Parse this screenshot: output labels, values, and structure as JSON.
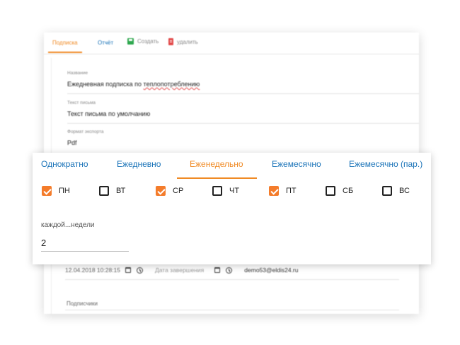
{
  "toolbar": {
    "tab_subscription": "Подписка",
    "tab_report": "Отчёт",
    "create_label": "Создать",
    "delete_label": "удалить"
  },
  "form": {
    "name_label": "Название",
    "name_value_prefix": "Ежедневная подписка по ",
    "name_value_underlined": "теплопотреблению",
    "letter_label": "Текст письма",
    "letter_value": "Текст письма по умолчанию",
    "export_label": "Формат экспорта",
    "export_value": "Pdf",
    "start_datetime": "12.04.2018 10:28:15",
    "end_date_placeholder": "Дата завершения",
    "email": "demo53@eldis24.ru",
    "subscribers_label": "Подписчики"
  },
  "schedule": {
    "tabs": [
      {
        "label": "Однократно",
        "active": false
      },
      {
        "label": "Ежедневно",
        "active": false
      },
      {
        "label": "Еженедельно",
        "active": true
      },
      {
        "label": "Ежемесячно",
        "active": false
      },
      {
        "label": "Ежемесячно (пар.)",
        "active": false
      }
    ],
    "days": [
      {
        "label": "ПН",
        "checked": true
      },
      {
        "label": "ВТ",
        "checked": false
      },
      {
        "label": "СР",
        "checked": true
      },
      {
        "label": "ЧТ",
        "checked": false
      },
      {
        "label": "ПТ",
        "checked": true
      },
      {
        "label": "СБ",
        "checked": false
      },
      {
        "label": "ВС",
        "checked": false
      }
    ],
    "interval_label": "каждой...недели",
    "interval_value": "2"
  },
  "colors": {
    "accent": "#f08a24",
    "checkbox_checked": "#f47c2b",
    "link_blue": "#1a73b8"
  }
}
